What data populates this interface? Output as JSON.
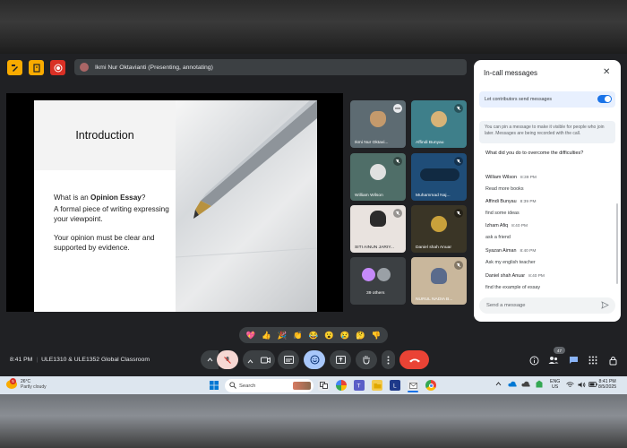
{
  "presenter_bar": {
    "label": "Ikmi Nur Oktavianti (Presenting, annotating)"
  },
  "slide": {
    "title": "Introduction",
    "question_prefix": "What is an ",
    "question_bold": "Opinion Essay",
    "question_suffix": "?",
    "definition": "A formal piece of writing expressing your viewpoint.",
    "note": "Your opinion must be clear and supported by evidence."
  },
  "tiles": [
    {
      "name": "Ikmi Nur Oktavi..."
    },
    {
      "name": "Affindi Bunyau"
    },
    {
      "name": "William Wilson"
    },
    {
      "name": "Muhammad Naj..."
    },
    {
      "name": "SITI AINUN JARIY..."
    },
    {
      "name": "Daniel shah Anuar"
    },
    {
      "name": "39 others"
    },
    {
      "name": "NURUL NADIA B..."
    }
  ],
  "panel": {
    "title": "In-call messages",
    "toggle_label": "Let contributors send messages",
    "pin_note": "You can pin a message to make it visible for people who join later. Messages are being recorded with the call.",
    "question": "What did you do to overcome the difficulties?",
    "messages": [
      {
        "sender": "William Wilson",
        "time": "8:39 PM",
        "text": "Read more books"
      },
      {
        "sender": "Affindi Bunyau",
        "time": "8:39 PM",
        "text": "find some ideas"
      },
      {
        "sender": "Izham Afiq",
        "time": "8:40 PM",
        "text": "ask a friend"
      },
      {
        "sender": "Syazan Aiman",
        "time": "8:40 PM",
        "text": "Ask my english teacher"
      },
      {
        "sender": "Daniel shah Anuar",
        "time": "8:40 PM",
        "text": "find the example of essay"
      }
    ],
    "input_placeholder": "Send a message"
  },
  "reactions": [
    "💖",
    "👍",
    "🎉",
    "👏",
    "😂",
    "😮",
    "😢",
    "🤔",
    "👎"
  ],
  "meeting": {
    "time": "8:41 PM",
    "separator": "|",
    "title": "ULE1310 & ULE1352 Global Classroom"
  },
  "participants_count": "47",
  "taskbar": {
    "weather_badge": "5",
    "temp": "26°C",
    "condition": "Partly cloudy",
    "search_placeholder": "Search",
    "language_line1": "ENG",
    "language_line2": "US",
    "clock_time": "8:41 PM",
    "clock_date": "8/5/2025"
  },
  "colors": {
    "meet_bg": "#202124",
    "accent_blue": "#1a73e8",
    "end_call_red": "#ea4335",
    "mic_off_bg": "#f6d7d3",
    "active_purple": "#a8c7fa"
  }
}
